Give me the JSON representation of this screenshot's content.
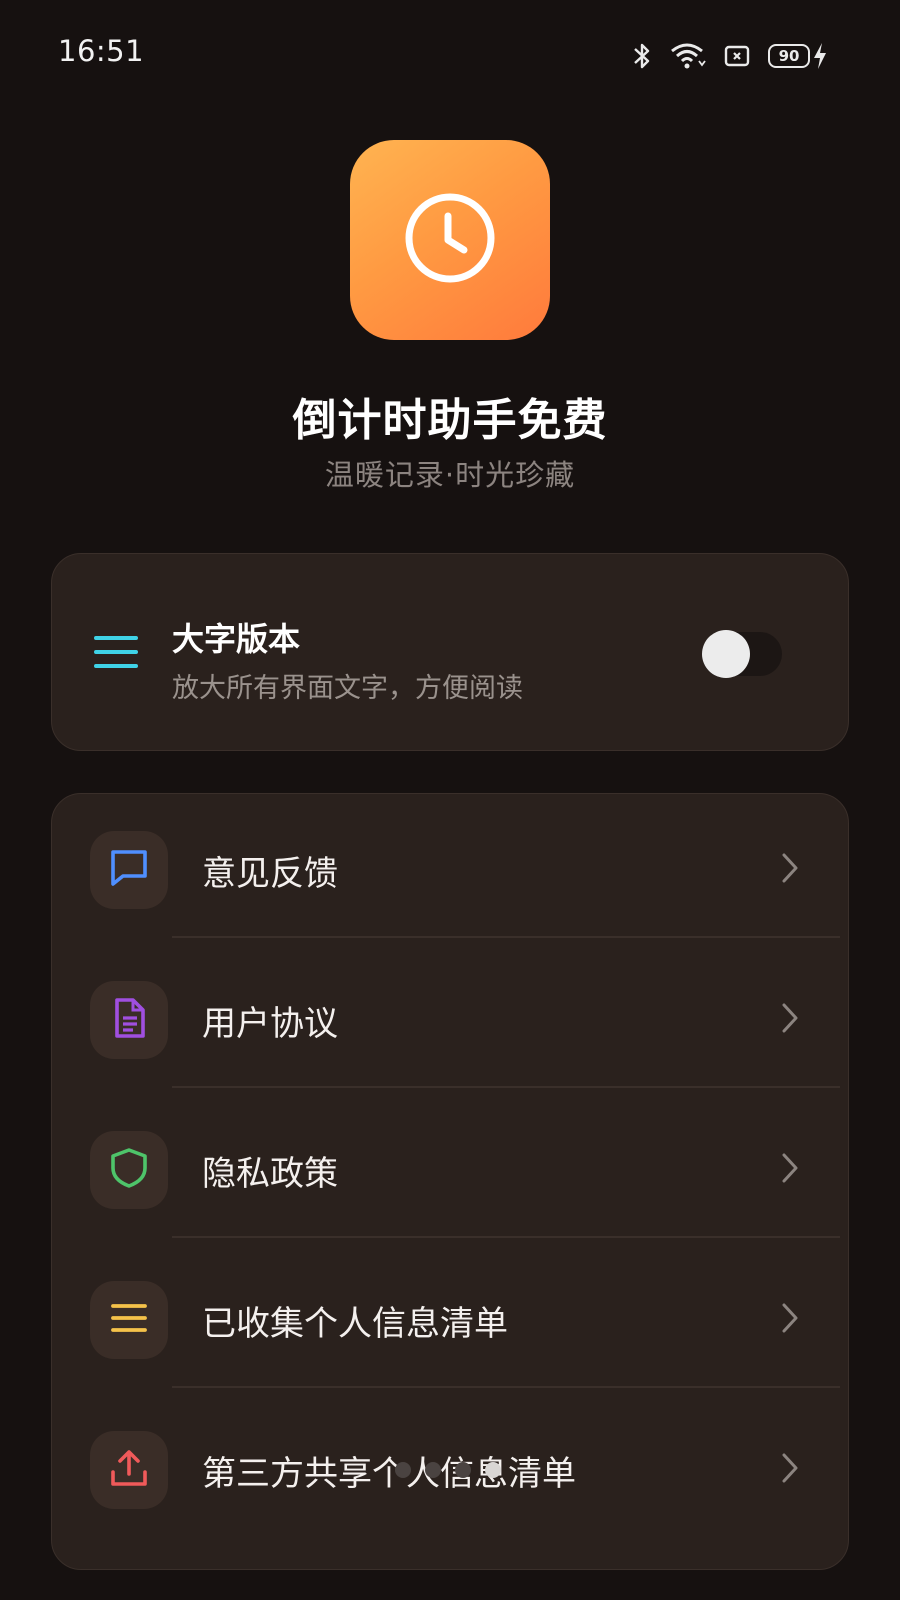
{
  "status_bar": {
    "time": "16:51",
    "battery_level": "90",
    "icons": [
      "bluetooth-icon",
      "wifi-icon",
      "sim-icon",
      "battery-icon",
      "charging-icon"
    ]
  },
  "app": {
    "name": "倒计时助手免费",
    "tagline": "温暖记录·时光珍藏",
    "icon": "clock-icon",
    "icon_gradient": [
      "#ffb451",
      "#ff7a3c"
    ]
  },
  "big_font": {
    "title": "大字版本",
    "description": "放大所有界面文字，方便阅读",
    "icon": "menu-lines-icon",
    "enabled": false
  },
  "menu": {
    "items": [
      {
        "label": "意见反馈",
        "icon": "feedback-icon",
        "color": "#4f8fff"
      },
      {
        "label": "用户协议",
        "icon": "document-icon",
        "color": "#a04fe0"
      },
      {
        "label": "隐私政策",
        "icon": "shield-icon",
        "color": "#4ec46a"
      },
      {
        "label": "已收集个人信息清单",
        "icon": "list-icon",
        "color": "#f5c24a"
      },
      {
        "label": "第三方共享个人信息清单",
        "icon": "share-upload-icon",
        "color": "#f05a5a"
      }
    ]
  },
  "page_indicator": {
    "count": 4,
    "active_index": 3
  },
  "colors": {
    "background": "#161110",
    "card": "#2a211d",
    "accent_cyan": "#3fd2e6"
  }
}
